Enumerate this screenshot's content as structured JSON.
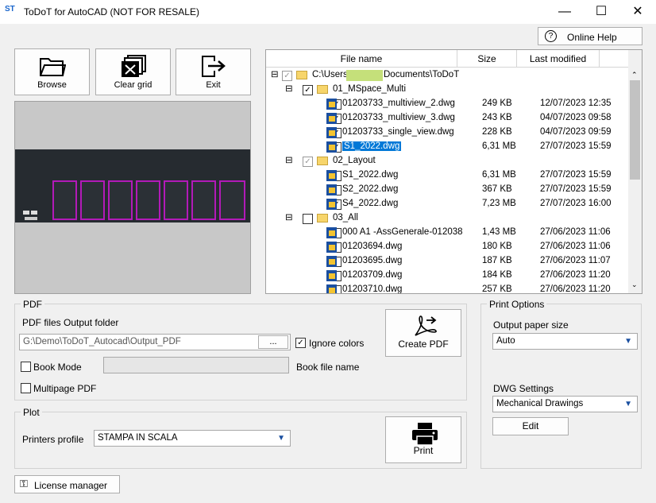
{
  "window": {
    "title": "ToDoT for AutoCAD (NOT FOR RESALE)",
    "icon_text": "ST"
  },
  "toolbar": {
    "online_help": "Online Help",
    "browse": "Browse",
    "clear_grid": "Clear grid",
    "exit": "Exit"
  },
  "grid": {
    "headers": [
      "File name",
      "Size",
      "Last modified"
    ],
    "root": {
      "prefix": "C:\\Users",
      "suffix": "Documents\\ToDoT"
    },
    "rows": [
      {
        "name": "01_MSpace_Multi",
        "size": "",
        "date": "",
        "folder": true,
        "checked": true
      },
      {
        "name": "01203733_multiview_2.dwg",
        "size": "249 KB",
        "date": "12/07/2023 12:35",
        "checked": true
      },
      {
        "name": "01203733_multiview_3.dwg",
        "size": "243 KB",
        "date": "04/07/2023 09:58",
        "checked": true
      },
      {
        "name": "01203733_single_view.dwg",
        "size": "228 KB",
        "date": "04/07/2023 09:59",
        "checked": true
      },
      {
        "name": "S1_2022.dwg",
        "size": "6,31 MB",
        "date": "27/07/2023 15:59",
        "checked": true,
        "selected": true
      },
      {
        "name": "02_Layout",
        "size": "",
        "date": "",
        "folder": true,
        "checked": true,
        "grey": true
      },
      {
        "name": "S1_2022.dwg",
        "size": "6,31 MB",
        "date": "27/07/2023 15:59",
        "checked": false
      },
      {
        "name": "S2_2022.dwg",
        "size": "367 KB",
        "date": "27/07/2023 15:59",
        "checked": false
      },
      {
        "name": "S4_2022.dwg",
        "size": "7,23 MB",
        "date": "27/07/2023 16:00",
        "checked": true
      },
      {
        "name": "03_All",
        "size": "",
        "date": "",
        "folder": true,
        "checked": false
      },
      {
        "name": "000 A1 -AssGenerale-012038",
        "size": "1,43 MB",
        "date": "27/06/2023 11:06",
        "checked": false
      },
      {
        "name": "01203694.dwg",
        "size": "180 KB",
        "date": "27/06/2023 11:06",
        "checked": false
      },
      {
        "name": "01203695.dwg",
        "size": "187 KB",
        "date": "27/06/2023 11:07",
        "checked": false
      },
      {
        "name": "01203709.dwg",
        "size": "184 KB",
        "date": "27/06/2023 11:20",
        "checked": false
      },
      {
        "name": "01203710.dwg",
        "size": "257 KB",
        "date": "27/06/2023 11:20",
        "checked": false
      }
    ]
  },
  "pdf": {
    "group_label": "PDF",
    "output_folder_label": "PDF files Output folder",
    "output_folder_value": "G:\\Demo\\ToDoT_Autocad\\Output_PDF",
    "browse_dots": "...",
    "ignore_colors": "Ignore colors",
    "book_mode": "Book Mode",
    "book_file_name": "Book file name",
    "multipage": "Multipage PDF",
    "create_pdf": "Create PDF"
  },
  "plot": {
    "group_label": "Plot",
    "printers_profile_label": "Printers profile",
    "printers_profile_value": "STAMPA IN SCALA",
    "print": "Print"
  },
  "print_options": {
    "group_label": "Print Options",
    "paper_size_label": "Output paper size",
    "paper_size_value": "Auto",
    "dwg_settings_label": "DWG Settings",
    "dwg_settings_value": "Mechanical Drawings",
    "edit": "Edit"
  },
  "license": "License manager",
  "colors": {
    "selection": "#0078d7",
    "sheet_border": "#b21ab8",
    "preview_bg": "#262b30"
  }
}
